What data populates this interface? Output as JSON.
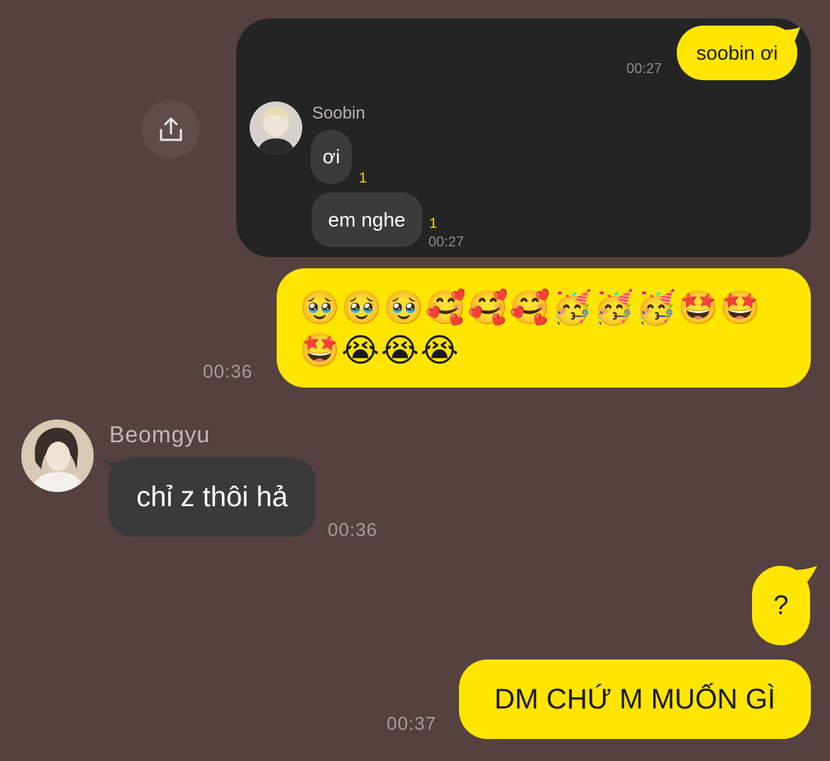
{
  "shared_card": {
    "sent_message": {
      "text": "soobin ơi",
      "time": "00:27"
    },
    "sender_name": "Soobin",
    "replies": [
      {
        "text": "ơi",
        "unread": "1"
      },
      {
        "text": "em nghe",
        "unread": "1",
        "time": "00:27"
      }
    ]
  },
  "share_button": {
    "icon": "share-icon"
  },
  "messages": [
    {
      "type": "sent",
      "emoji_row_1": "🥹🥹🥹🥰🥰🥰🥳🥳🥳🤩🤩",
      "emoji_row_2": "🤩😭😭😭",
      "time": "00:36"
    },
    {
      "type": "received",
      "sender": "Beomgyu",
      "text": "chỉ z thôi hả",
      "time": "00:36"
    },
    {
      "type": "sent",
      "text": "?"
    },
    {
      "type": "sent",
      "text": "DM CHỨ M MUỐN GÌ",
      "time": "00:37"
    }
  ],
  "colors": {
    "background": "#554140",
    "sent_bubble": "#ffe500",
    "received_bubble": "#3a3a3a",
    "card": "#242424"
  }
}
